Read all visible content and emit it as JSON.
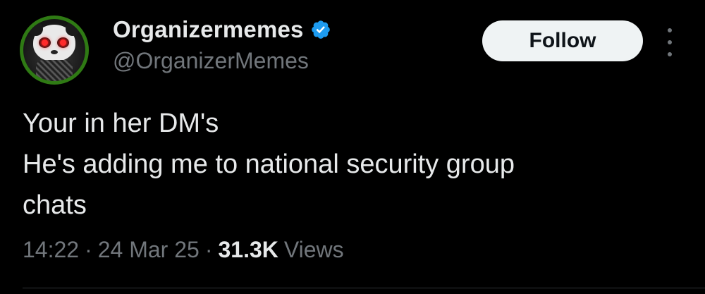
{
  "author": {
    "display_name": "Organizermemes",
    "handle": "@OrganizerMemes",
    "verified": true,
    "avatar_icon": "panda-avatar"
  },
  "actions": {
    "follow_label": "Follow",
    "more_icon": "more-vertical-icon"
  },
  "tweet": {
    "lines": [
      "Your in her DM's",
      "He's adding me to national security group",
      "chats"
    ]
  },
  "meta": {
    "time": "14:22",
    "separator": "·",
    "date": "24 Mar 25",
    "views_count": "31.3K",
    "views_label": "Views"
  },
  "colors": {
    "background": "#000000",
    "text_primary": "#e7e9ea",
    "text_secondary": "#71767b",
    "verified_badge": "#1d9bf0",
    "follow_button_bg": "#eff3f4",
    "avatar_ring": "#2f7a14"
  }
}
